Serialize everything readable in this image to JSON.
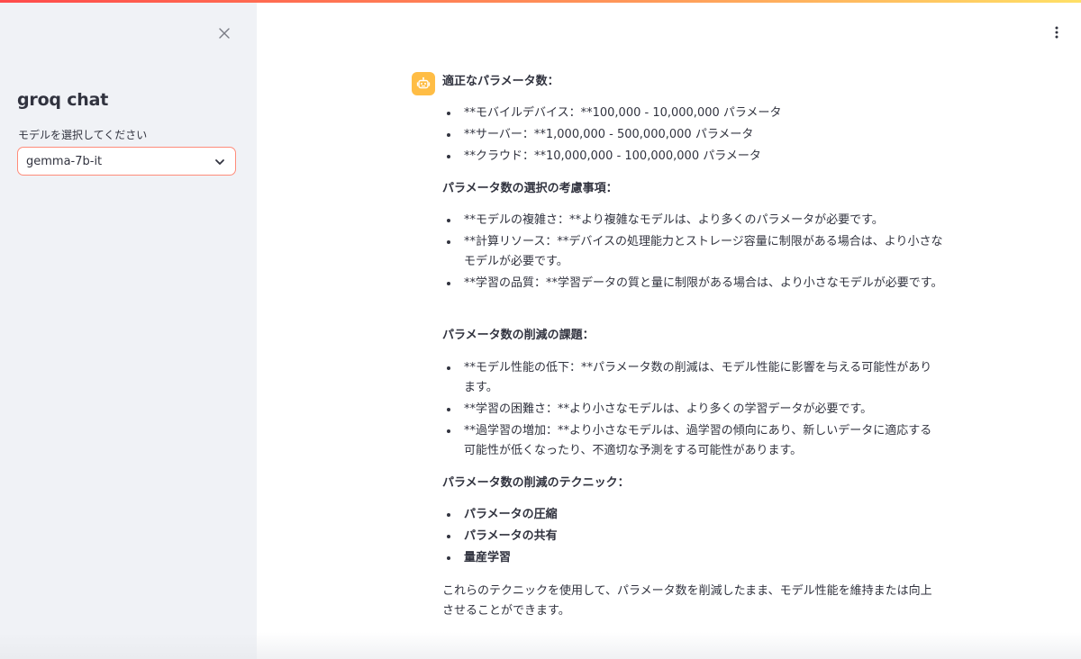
{
  "sidebar": {
    "app_title": "groq chat",
    "select_label": "モデルを選択してください",
    "selected_model": "gemma-7b-it"
  },
  "message": {
    "heading1": "適正なパラメータ数：",
    "list1": [
      "**モバイルデバイス：**100,000 - 10,000,000 パラメータ",
      "**サーバー：**1,000,000 - 500,000,000 パラメータ",
      "**クラウド：**10,000,000 - 100,000,000 パラメータ"
    ],
    "heading2": "パラメータ数の選択の考慮事項：",
    "list2": [
      "**モデルの複雑さ：**より複雑なモデルは、より多くのパラメータが必要です。",
      "**計算リソース：**デバイスの処理能力とストレージ容量に制限がある場合は、より小さなモデルが必要です。",
      "**学習の品質：**学習データの質と量に制限がある場合は、より小さなモデルが必要です。"
    ],
    "heading3": "パラメータ数の削減の課題：",
    "list3": [
      "**モデル性能の低下：**パラメータ数の削減は、モデル性能に影響を与える可能性があります。",
      "**学習の困難さ：**より小さなモデルは、より多くの学習データが必要です。",
      "**過学習の増加：**より小さなモデルは、過学習の傾向にあり、新しいデータに適応する可能性が低くなったり、不適切な予測をする可能性があります。"
    ],
    "heading4": "パラメータ数の削減のテクニック：",
    "list4": [
      "パラメータの圧縮",
      "パラメータの共有",
      "量産学習"
    ],
    "closing": "これらのテクニックを使用して、パラメータ数を削減したまま、モデル性能を維持または向上させることができます。"
  },
  "icons": {
    "close": "close-icon",
    "chevron": "chevron-down-icon",
    "menu": "kebab-menu-icon",
    "avatar": "robot-icon"
  },
  "colors": {
    "sidebar_bg": "#f0f2f6",
    "select_border": "#ff8c7a",
    "avatar_bg": "#ffbd45",
    "text": "#31333f"
  }
}
